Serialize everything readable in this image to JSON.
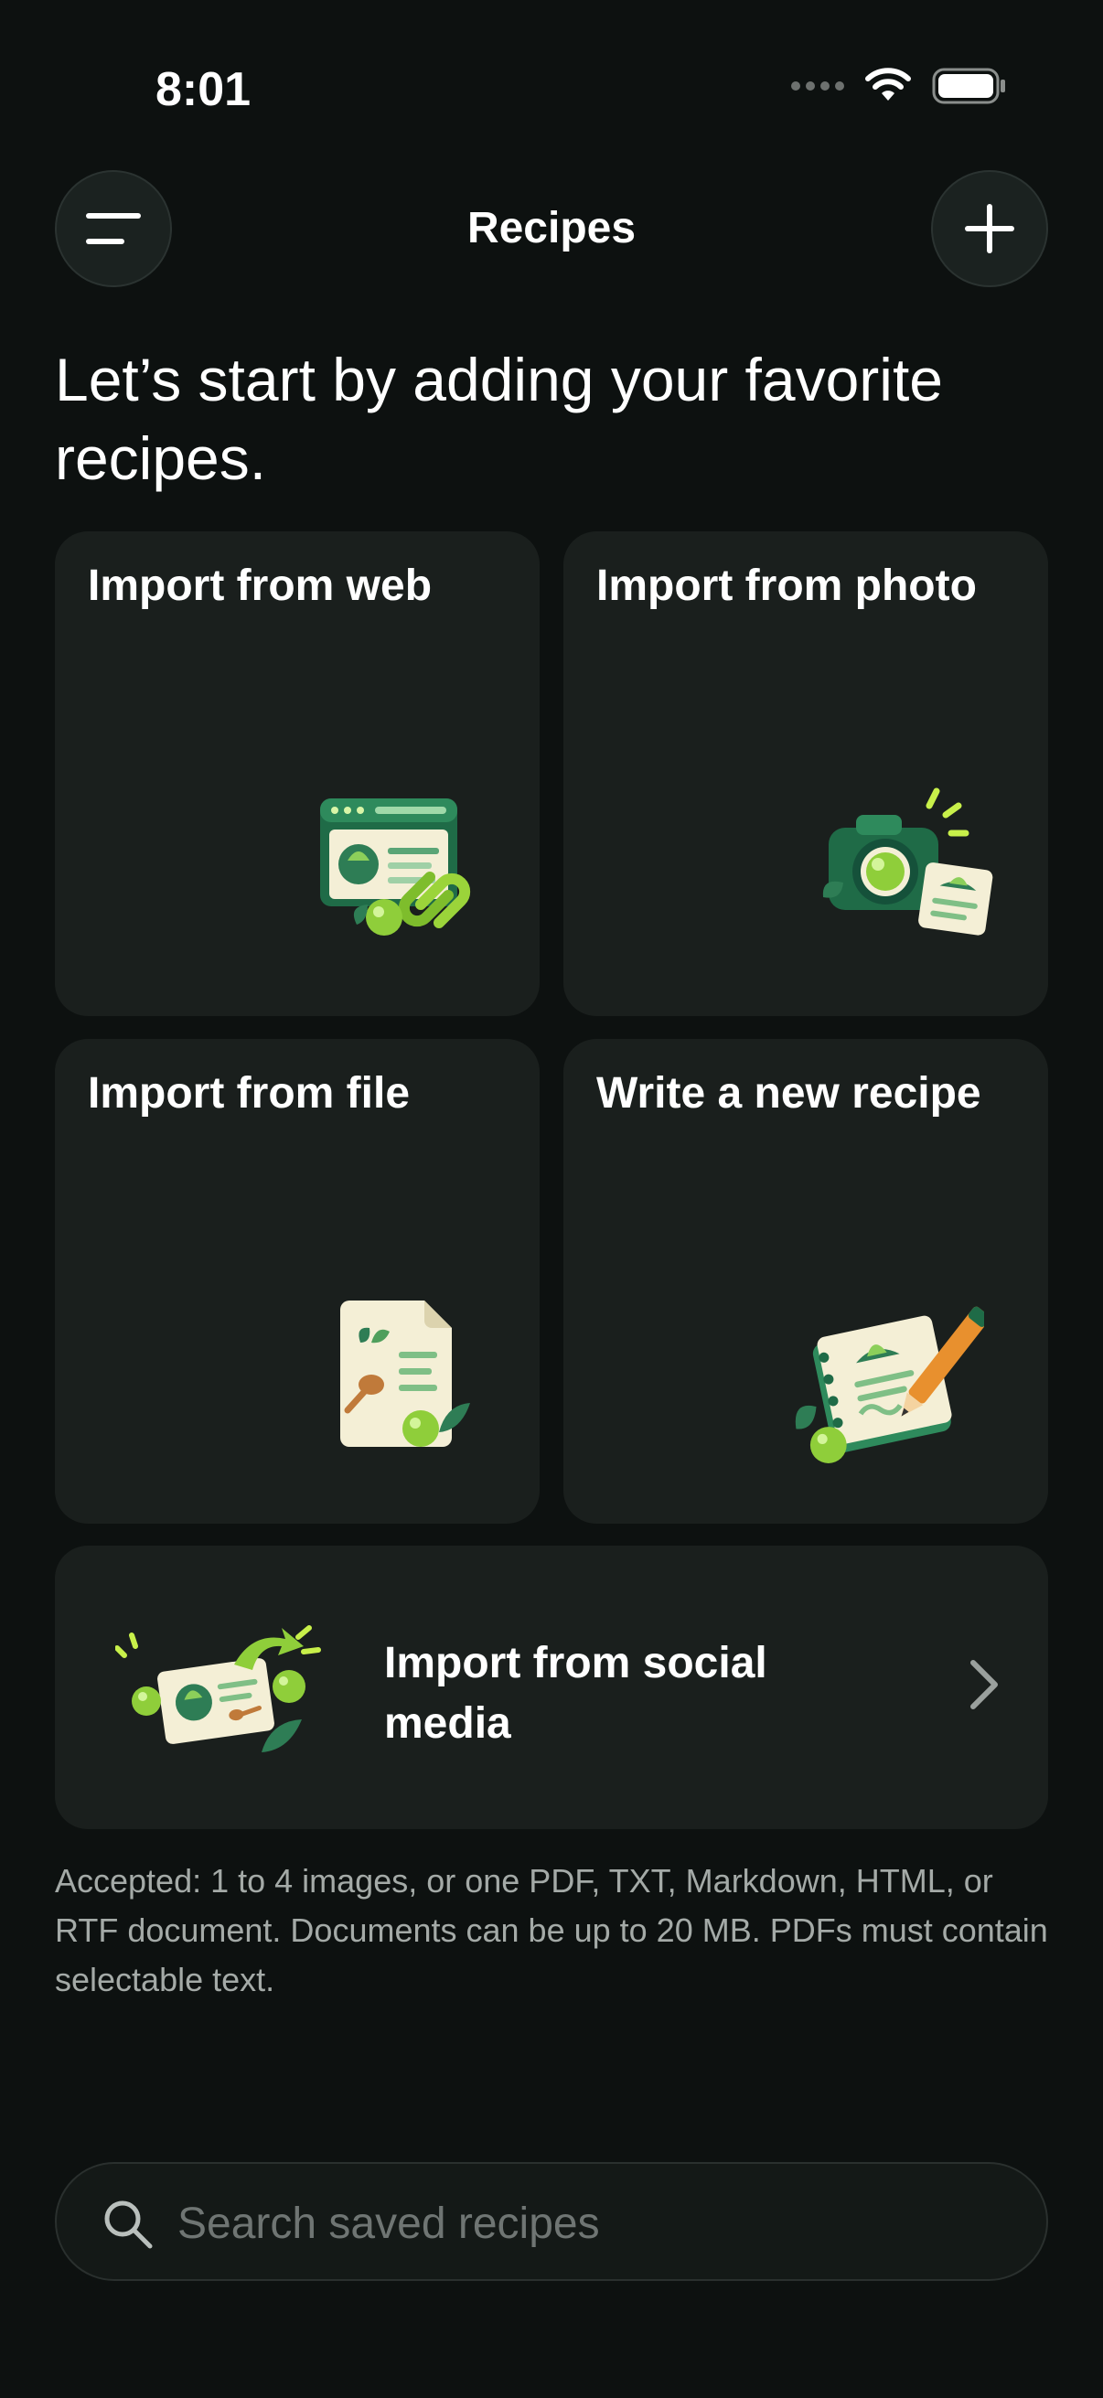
{
  "status_bar": {
    "time": "8:01"
  },
  "header": {
    "title": "Recipes",
    "menu_icon": "hamburger-menu-icon",
    "add_icon": "plus-icon"
  },
  "headline": "Let’s start by adding your favorite recipes.",
  "import_options": [
    {
      "label": "Import from web",
      "icon": "web-link-illustration"
    },
    {
      "label": "Import from photo",
      "icon": "camera-illustration"
    },
    {
      "label": "Import from file",
      "icon": "document-illustration"
    },
    {
      "label": "Write a new recipe",
      "icon": "notebook-pencil-illustration"
    }
  ],
  "social_import": {
    "label": "Import from social media",
    "icon": "social-share-illustration"
  },
  "accepted_note": "Accepted: 1 to 4 images, or one PDF, TXT, Markdown, HTML, or RTF document. Documents can be up to 20 MB. PDFs must contain selectable text.",
  "search": {
    "placeholder": "Search saved recipes",
    "value": ""
  },
  "colors": {
    "background": "#0d1110",
    "card": "#1a1f1d",
    "accent_green": "#2e7d55",
    "lime": "#9bd43a",
    "muted_text": "#a4aaa7"
  }
}
